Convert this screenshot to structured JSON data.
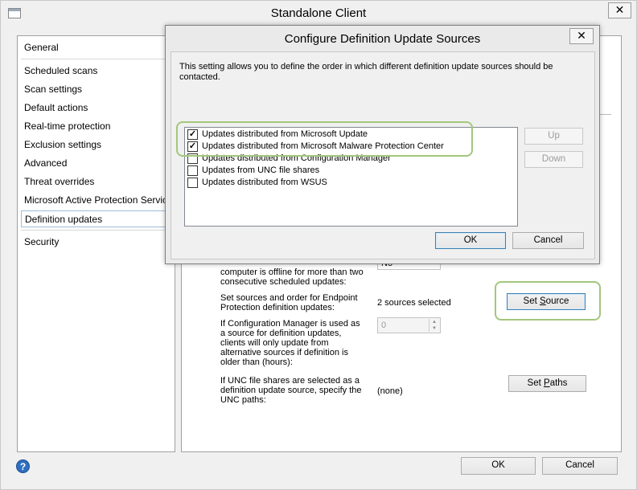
{
  "window": {
    "title": "Standalone Client",
    "close_glyph": "✕"
  },
  "sidebar": {
    "items": [
      {
        "label": "General"
      },
      {
        "label": "Scheduled scans"
      },
      {
        "label": "Scan settings"
      },
      {
        "label": "Default actions"
      },
      {
        "label": "Real-time protection"
      },
      {
        "label": "Exclusion settings"
      },
      {
        "label": "Advanced"
      },
      {
        "label": "Threat overrides"
      },
      {
        "label": "Microsoft Active Protection Service"
      },
      {
        "label": "Definition updates",
        "selected": true
      },
      {
        "label": "Security"
      }
    ]
  },
  "content": {
    "offline_dropdown_value": "No",
    "offline_label": "computer is offline for more than two consecutive scheduled updates:",
    "sources_label": "Set sources and order for Endpoint Protection definition updates:",
    "sources_value": "2 sources selected",
    "set_source_button_prefix": "Set ",
    "set_source_button_accel": "S",
    "set_source_button_rest": "ource",
    "cm_label": "If Configuration Manager is used as a source for definition updates, clients will only update from alternative sources if definition is older than (hours):",
    "cm_hours_value": "0",
    "unc_label": "If UNC file shares are selected as a definition update source, specify the UNC paths:",
    "unc_value": "(none)",
    "set_paths_button_prefix": "Set ",
    "set_paths_button_accel": "P",
    "set_paths_button_rest": "aths"
  },
  "dialog": {
    "title": "Configure Definition Update Sources",
    "close_glyph": "✕",
    "description": "This setting allows you to define the order in which different definition update sources should be contacted.",
    "sources": [
      {
        "label": "Updates distributed from Microsoft Update",
        "checked": true
      },
      {
        "label": "Updates distributed from Microsoft Malware Protection Center",
        "checked": true
      },
      {
        "label": "Updates distributed from Configuration Manager",
        "checked": false
      },
      {
        "label": "Updates from UNC file shares",
        "checked": false
      },
      {
        "label": "Updates distributed from WSUS",
        "checked": false
      }
    ],
    "up_label": "Up",
    "down_label": "Down",
    "ok_label": "OK",
    "cancel_label": "Cancel"
  },
  "footer": {
    "help_glyph": "?",
    "ok_label": "OK",
    "cancel_label": "Cancel"
  },
  "colors": {
    "highlight": "#a2c77c",
    "help_icon": "#2f6fc0"
  }
}
